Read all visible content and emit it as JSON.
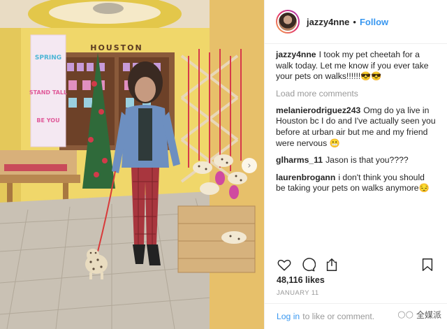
{
  "photo": {
    "store_sign": "HOUSTON",
    "banner_top": "SPRING",
    "banner_mid": "STAND TALL",
    "banner_bottom": "BE YOU"
  },
  "header": {
    "username": "jazzy4nne",
    "separator": "•",
    "follow_label": "Follow"
  },
  "caption": {
    "username": "jazzy4nne",
    "text": "I took my pet cheetah for a walk today. Let me know if you ever take your pets on walks!!!!!!😎😎"
  },
  "load_more_label": "Load more comments",
  "comments": [
    {
      "username": "melanierodriguez243",
      "text": "Omg do ya live in Houston bc I do and I've actually seen you before at urban air but me and my friend were nervous 😬"
    },
    {
      "username": "glharms_11",
      "text": "Jason is that you????"
    },
    {
      "username": "laurenbrogann",
      "text": "i don't think you should be taking your pets on walks anymore😔"
    }
  ],
  "actions": {
    "like_icon": "heart-icon",
    "comment_icon": "comment-icon",
    "share_icon": "share-icon",
    "save_icon": "bookmark-icon"
  },
  "likes_label": "48,116 likes",
  "date_label": "JANUARY 11",
  "footer": {
    "login_label": "Log in",
    "rest_label": "to like or comment."
  },
  "watermark": {
    "icon": "wechat-icon",
    "text": "全媒派"
  },
  "carousel": {
    "next_icon": "chevron-right-icon"
  }
}
